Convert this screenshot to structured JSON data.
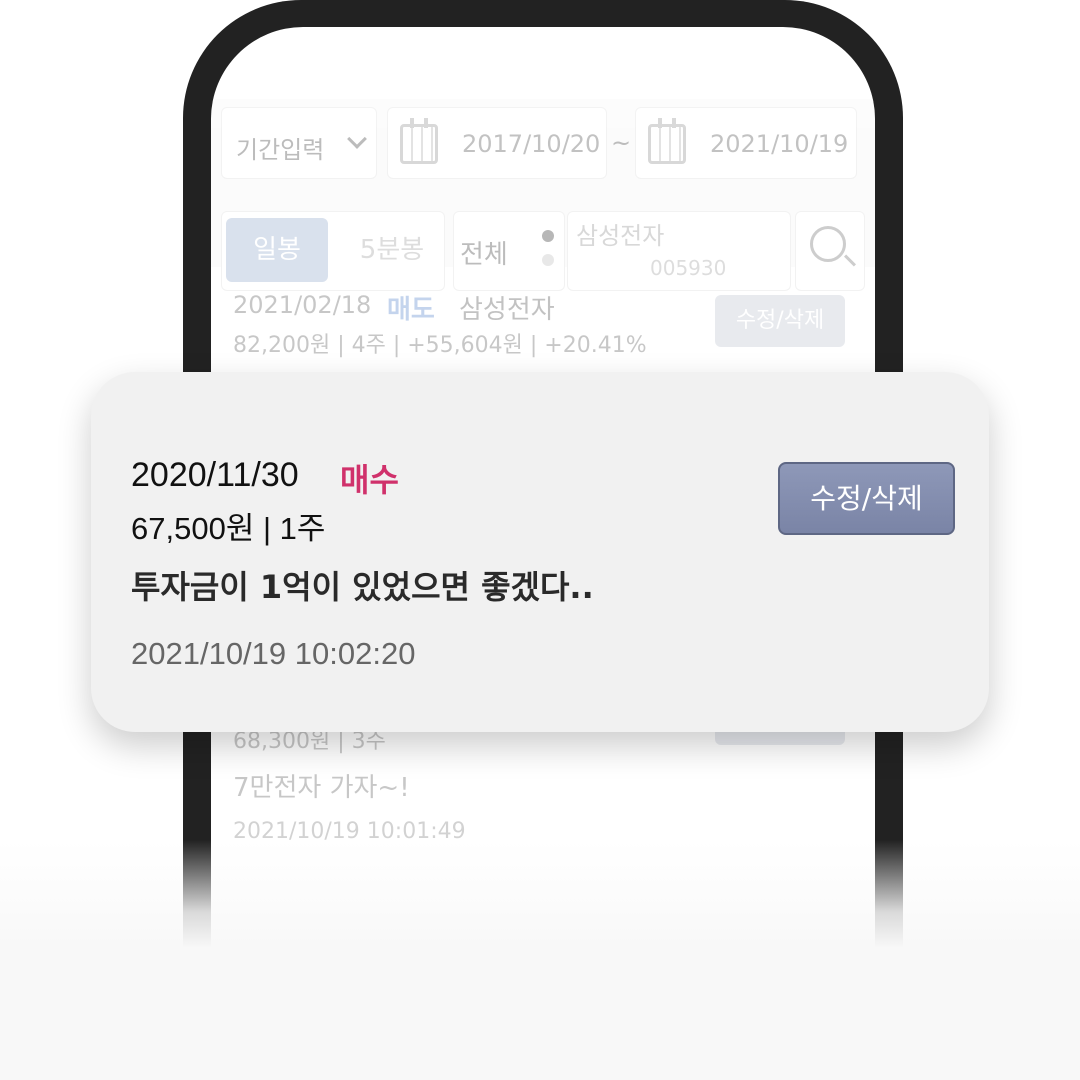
{
  "filters": {
    "period_label": "기간입력",
    "date_from": "2017/10/20",
    "tilde": "~",
    "date_to": "2021/10/19",
    "tab_day": "일봉",
    "tab_5min": "5분봉",
    "all_label": "전체",
    "stock_name": "삼성전자",
    "stock_code": "005930"
  },
  "list": [
    {
      "date": "2021/02/18",
      "type": "매도",
      "stock": "삼성전자",
      "info": "82,200원 | 4주 | +55,604원 | +20.41%",
      "button": "수정/삭제"
    },
    {
      "info": "68,300원 | 3주",
      "memo": "7만전자 가자~!",
      "timestamp": "2021/10/19  10:01:49"
    }
  ],
  "card": {
    "date": "2020/11/30",
    "type": "매수",
    "info": "67,500원 | 1주",
    "memo": "투자금이 1억이 있었으면 좋겠다..",
    "timestamp": "2021/10/19  10:02:20",
    "button": "수정/삭제"
  },
  "colors": {
    "buy": "#d0316b",
    "sell": "#4a7cc8",
    "button": "#7a84a6"
  }
}
